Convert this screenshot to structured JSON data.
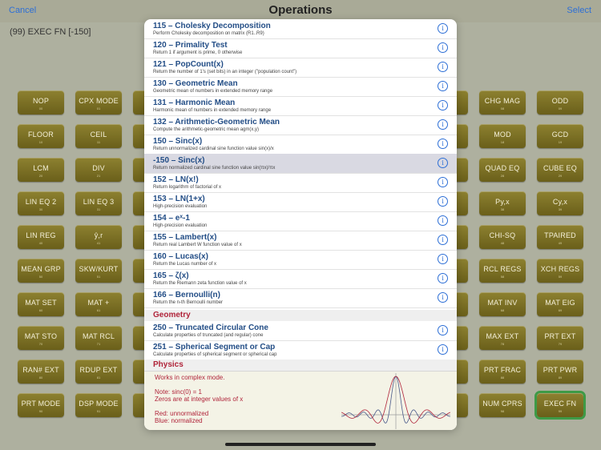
{
  "navbar": {
    "cancel": "Cancel",
    "title": "Operations",
    "select": "Select"
  },
  "display": {
    "text": "(99) EXEC FN [-150]"
  },
  "keys": {
    "nop": {
      "label": "NOP",
      "sub": "00"
    },
    "cpx_mode": {
      "label": "CPX MODE",
      "sub": "01"
    },
    "chg_mag": {
      "label": "CHG MAG",
      "sub": "08"
    },
    "odd": {
      "label": "ODD",
      "sub": "09"
    },
    "floor": {
      "label": "FLOOR",
      "sub": "10"
    },
    "ceil": {
      "label": "CEIL",
      "sub": "11"
    },
    "mod": {
      "label": "MOD",
      "sub": "18"
    },
    "gcd": {
      "label": "GCD",
      "sub": "19"
    },
    "lcm": {
      "label": "LCM",
      "sub": "20"
    },
    "div": {
      "label": "DIV",
      "sub": "21"
    },
    "quad_eq": {
      "label": "QUAD EQ",
      "sub": "28"
    },
    "cube_eq": {
      "label": "CUBE EQ",
      "sub": "29"
    },
    "lin_eq2": {
      "label": "LIN EQ 2",
      "sub": "30"
    },
    "lin_eq3": {
      "label": "LIN EQ 3",
      "sub": "31"
    },
    "pyx": {
      "label": "Py,x",
      "sub": "38"
    },
    "cyx": {
      "label": "Cy,x",
      "sub": "39"
    },
    "lin_reg": {
      "label": "LIN REG",
      "sub": "40"
    },
    "yhat_r": {
      "label": "ŷ,r",
      "sub": "41"
    },
    "chi_sq": {
      "label": "CHI-SQ",
      "sub": "48"
    },
    "tpaired": {
      "label": "TPAIRED",
      "sub": "49"
    },
    "mean_grp": {
      "label": "MEAN GRP",
      "sub": "50"
    },
    "skw_kurt": {
      "label": "SKW/KURT",
      "sub": "51"
    },
    "rcl_regs": {
      "label": "RCL REGS",
      "sub": "58"
    },
    "xch_regs": {
      "label": "XCH REGS",
      "sub": "59"
    },
    "mat_set": {
      "label": "MAT SET",
      "sub": "60"
    },
    "mat_plus": {
      "label": "MAT +",
      "sub": "61"
    },
    "mat_inv": {
      "label": "MAT INV",
      "sub": "68"
    },
    "mat_eig": {
      "label": "MAT EIG",
      "sub": "69"
    },
    "mat_sto": {
      "label": "MAT STO",
      "sub": "70"
    },
    "mat_rcl": {
      "label": "MAT RCL",
      "sub": "71"
    },
    "max_ext": {
      "label": "MAX EXT",
      "sub": "78"
    },
    "prt_ext": {
      "label": "PRT EXT",
      "sub": "79"
    },
    "ran_ext": {
      "label": "RAN# EXT",
      "sub": "80"
    },
    "rdup_ext": {
      "label": "RDUP EXT",
      "sub": "81"
    },
    "prt_frac": {
      "label": "PRT FRAC",
      "sub": "88"
    },
    "prt_pwr": {
      "label": "PRT PWR",
      "sub": "89"
    },
    "prt_mode": {
      "label": "PRT MODE",
      "sub": "90"
    },
    "dsp_mode": {
      "label": "DSP MODE",
      "sub": "91"
    },
    "num_cprs": {
      "label": "NUM CPRS",
      "sub": "98"
    },
    "exec_fn": {
      "label": "EXEC FN",
      "sub": "99"
    }
  },
  "list": [
    {
      "title": "115 – Cholesky Decomposition",
      "desc": "Perform Cholesky decomposition on matrix (R1..R9)"
    },
    {
      "title": "120 – Primality Test",
      "desc": "Return 1 if argument is prime, 0 otherwise"
    },
    {
      "title": "121 – PopCount(x)",
      "desc": "Return the number of 1's (set bits) in an integer (\"population count\")"
    },
    {
      "title": "130 – Geometric Mean",
      "desc": "Geometric mean of numbers in extended memory range"
    },
    {
      "title": "131 – Harmonic Mean",
      "desc": "Harmonic mean of numbers in extended memory range"
    },
    {
      "title": "132 – Arithmetic-Geometric Mean",
      "desc": "Compute the arithmetic-geometric mean agm(x,y)"
    },
    {
      "title": "150 – Sinc(x)",
      "desc": "Return unnormalized cardinal sine function value sin(x)/x"
    },
    {
      "title": "-150 – Sinc(x)",
      "desc": "Return normalized cardinal sine function value sin(πx)/πx"
    },
    {
      "title": "152 – LN(x!)",
      "desc": "Return logarithm of factorial of x"
    },
    {
      "title": "153 – LN(1+x)",
      "desc": "High-precision evaluation"
    },
    {
      "title": "154 – eˣ-1",
      "desc": "High-precision evaluation"
    },
    {
      "title": "155 – Lambert(x)",
      "desc": "Return real Lambert W function value of x"
    },
    {
      "title": "160 – Lucas(x)",
      "desc": "Return the Lucas number of x"
    },
    {
      "title": "165 – ζ(x)",
      "desc": "Return the Riemann zeta function value of x"
    },
    {
      "title": "166 – Bernoulli(n)",
      "desc": "Return the n-th Bernoulli number"
    }
  ],
  "section_geometry": "Geometry",
  "list_geometry": [
    {
      "title": "250 – Truncated Circular Cone",
      "desc": "Calculate properties of truncated (and regular) cone"
    },
    {
      "title": "251 – Spherical Segment or Cap",
      "desc": "Calculate properties of spherical segment or spherical cap"
    }
  ],
  "section_physics": "Physics",
  "help": {
    "line1": "Works in complex mode.",
    "line2": "Note: sinc(0) = 1",
    "line3": "Zeros are at integer values of x",
    "line4": "Red: unnormalized",
    "line5": "Blue: normalized",
    "colors": {
      "red": "#b0243a",
      "blue": "#4a5a8a"
    }
  }
}
